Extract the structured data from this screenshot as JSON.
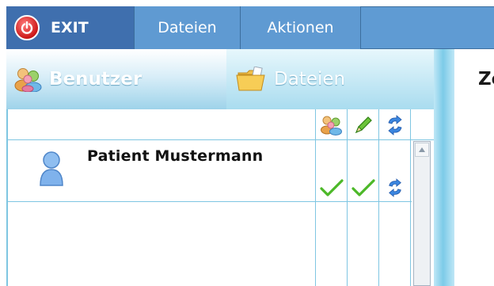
{
  "menu": {
    "exit_label": "EXIT",
    "dateien_label": "Dateien",
    "aktionen_label": "Aktionen"
  },
  "tabs": {
    "benutzer_label": "Benutzer",
    "dateien_label": "Dateien",
    "right_partial_label": "Ze"
  },
  "table": {
    "rows": [
      {
        "name": "Patient Mustermann"
      }
    ]
  },
  "colors": {
    "menu_bg": "#5f9ad2",
    "menu_exit_bg": "#3f6fae",
    "tab_gradient_end": "#8fd1ea",
    "grid_line": "#7fc6e2",
    "check_green": "#4cb828",
    "sync_blue": "#2a6fd6"
  }
}
